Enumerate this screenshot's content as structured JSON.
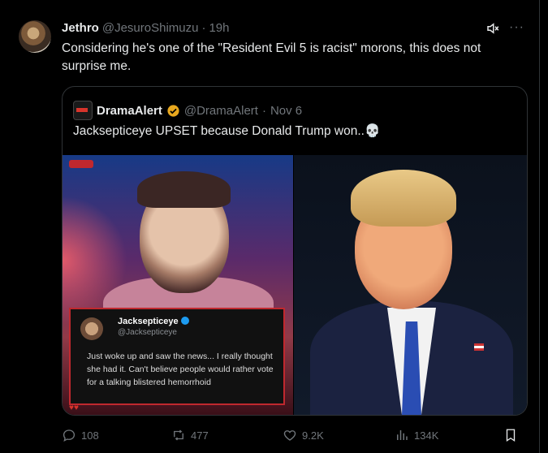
{
  "tweet": {
    "author_name": "Jethro",
    "author_handle": "@JesuroShimuzu",
    "separator": "·",
    "time": "19h",
    "text": "Considering he's one of the \"Resident Evil 5 is racist\" morons, this does not surprise me."
  },
  "quote": {
    "author_name": "DramaAlert",
    "author_handle": "@DramaAlert",
    "separator": "·",
    "date": "Nov 6",
    "text": "Jacksepticeye UPSET because Donald Trump won..💀",
    "image_card": {
      "name": "Jacksepticeye",
      "handle": "@Jacksepticeye",
      "text": "Just woke up and saw the news... I really thought she had it. Can't believe people would rather vote for a talking blistered hemorrhoid"
    }
  },
  "actions": {
    "replies": "108",
    "reposts": "477",
    "likes": "9.2K",
    "views": "134K"
  },
  "colors": {
    "background": "#000000",
    "text": "#e7e9ea",
    "muted": "#71767b",
    "verified_gold": "#e8a81e",
    "accent_red": "#c0282e"
  },
  "icons": [
    "mute-icon",
    "more-icon",
    "verified-gold-icon",
    "skull-icon",
    "reply-icon",
    "repost-icon",
    "like-icon",
    "views-icon",
    "bookmark-icon"
  ]
}
